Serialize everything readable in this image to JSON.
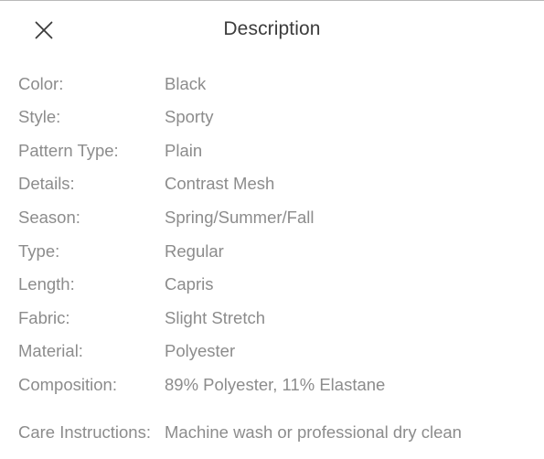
{
  "header": {
    "title": "Description",
    "close_icon": "close-icon"
  },
  "colors": {
    "background": "#ffffff",
    "title_text": "#3c3c3c",
    "label_text": "#8c8c8c",
    "value_text": "#8c8c8c",
    "close_icon": "#3c3c3c",
    "top_border": "#b9b9b9"
  },
  "specs": [
    {
      "label": "Color:",
      "value": "Black"
    },
    {
      "label": "Style:",
      "value": "Sporty"
    },
    {
      "label": "Pattern Type:",
      "value": "Plain"
    },
    {
      "label": "Details:",
      "value": "Contrast Mesh"
    },
    {
      "label": "Season:",
      "value": "Spring/Summer/Fall"
    },
    {
      "label": "Type:",
      "value": "Regular"
    },
    {
      "label": "Length:",
      "value": "Capris"
    },
    {
      "label": "Fabric:",
      "value": "Slight Stretch"
    },
    {
      "label": "Material:",
      "value": "Polyester"
    },
    {
      "label": "Composition:",
      "value": "89% Polyester, 11% Elastane"
    },
    {
      "label": "Care Instructions:",
      "value": "Machine wash or professional dry clean"
    }
  ]
}
